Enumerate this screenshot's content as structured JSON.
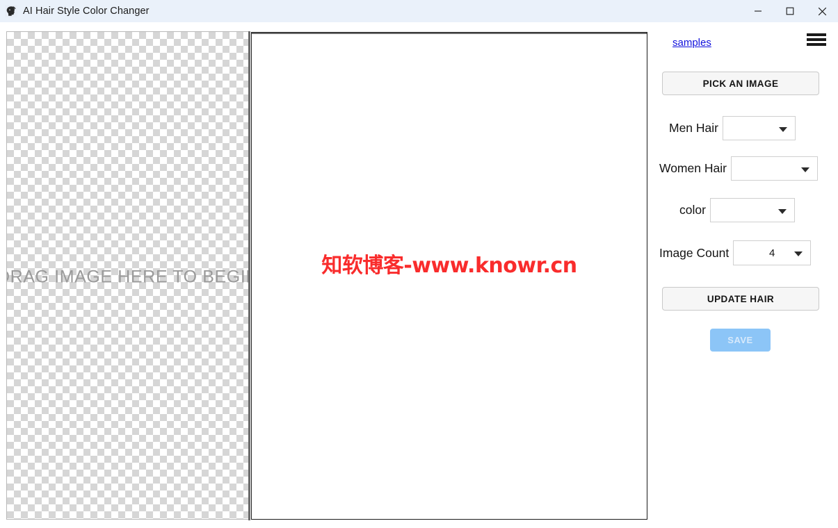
{
  "window": {
    "title": "AI Hair Style Color Changer",
    "icon": "head-silhouette-icon",
    "controls": {
      "minimize": "minimize-icon",
      "maximize": "maximize-icon",
      "close": "close-icon"
    }
  },
  "drop_area": {
    "placeholder": "DRAG IMAGE HERE TO BEGIN"
  },
  "canvas": {
    "watermark": "知软博客-www.knowr.cn"
  },
  "panel": {
    "samples_link": "samples",
    "menu_icon": "hamburger-menu-icon",
    "pick_image_label": "PICK AN IMAGE",
    "update_hair_label": "UPDATE HAIR",
    "save_label": "SAVE",
    "controls": [
      {
        "label": "Men Hair",
        "value": "",
        "name": "men-hair"
      },
      {
        "label": "Women Hair",
        "value": "",
        "name": "women-hair"
      },
      {
        "label": "color",
        "value": "",
        "name": "color"
      },
      {
        "label": "Image Count",
        "value": "4",
        "name": "image-count"
      }
    ]
  },
  "colors": {
    "titlebar_bg": "#eaf1fa",
    "link": "#1111dd",
    "watermark": "#f92c2c",
    "save_button_bg": "#8cc5f7",
    "save_button_text": "#d7e9fb",
    "button_bg": "#f6f6f6",
    "drop_text": "#9a9a9a",
    "divider": "#6a6a6a"
  }
}
